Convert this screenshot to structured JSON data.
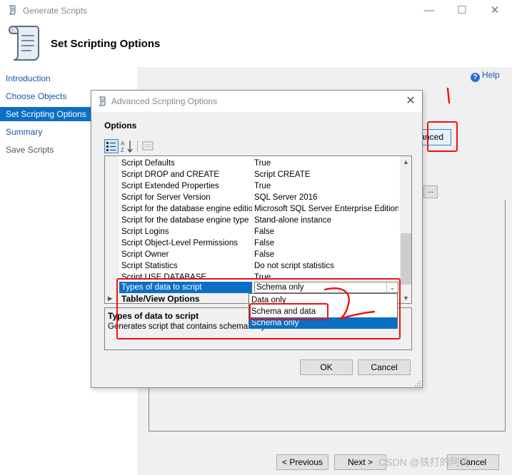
{
  "window": {
    "title": "Generate Scripts",
    "controls": {
      "minimize": "—",
      "maximize": "☐",
      "close": "✕"
    }
  },
  "header": {
    "title": "Set Scripting Options"
  },
  "nav": {
    "items": [
      {
        "label": "Introduction",
        "state": "link"
      },
      {
        "label": "Choose Objects",
        "state": "link"
      },
      {
        "label": "Set Scripting Options",
        "state": "active"
      },
      {
        "label": "Summary",
        "state": "link"
      },
      {
        "label": "Save Scripts",
        "state": "disabled"
      }
    ]
  },
  "content": {
    "help_label": "Help",
    "help_icon": "?",
    "advanced_label": "anced",
    "ellipsis_label": "..."
  },
  "footer": {
    "previous_label": "< Previous",
    "next_label": "Next >",
    "cancel_label": "Cancel"
  },
  "dialog": {
    "title": "Advanced Scripting Options",
    "close": "✕",
    "options_label": "Options",
    "rows": [
      {
        "name": "Script Defaults",
        "value": "True"
      },
      {
        "name": "Script DROP and CREATE",
        "value": "Script CREATE"
      },
      {
        "name": "Script Extended Properties",
        "value": "True"
      },
      {
        "name": "Script for Server Version",
        "value": "SQL Server 2016"
      },
      {
        "name": "Script for the database engine edition",
        "value": "Microsoft SQL Server Enterprise Edition"
      },
      {
        "name": "Script for the database engine type",
        "value": "Stand-alone instance"
      },
      {
        "name": "Script Logins",
        "value": "False"
      },
      {
        "name": "Script Object-Level Permissions",
        "value": "False"
      },
      {
        "name": "Script Owner",
        "value": "False"
      },
      {
        "name": "Script Statistics",
        "value": "Do not script statistics"
      },
      {
        "name": "Script USE DATABASE",
        "value": "True"
      }
    ],
    "selected_row": {
      "name": "Types of data to script",
      "value": "Schema only",
      "arrow": "⌄"
    },
    "category": {
      "name": "Table/View Options",
      "expander": "▶"
    },
    "scroll": {
      "up": "▲",
      "down": "▼"
    },
    "description": {
      "title": "Types of data to script",
      "text": "Generates script that contains schema only"
    },
    "dropdown_options": [
      {
        "label": "Data only",
        "selected": false
      },
      {
        "label": "Schema and data",
        "selected": false
      },
      {
        "label": "Schema only",
        "selected": true
      }
    ],
    "ok_label": "OK",
    "cancel_label": "Cancel"
  },
  "watermark": "CSDN @铁打的阿秀",
  "colors": {
    "selection": "#0b6fc4",
    "link": "#1a56b0",
    "annotation": "#f01010",
    "dialog_bg": "#f0f0f0"
  }
}
